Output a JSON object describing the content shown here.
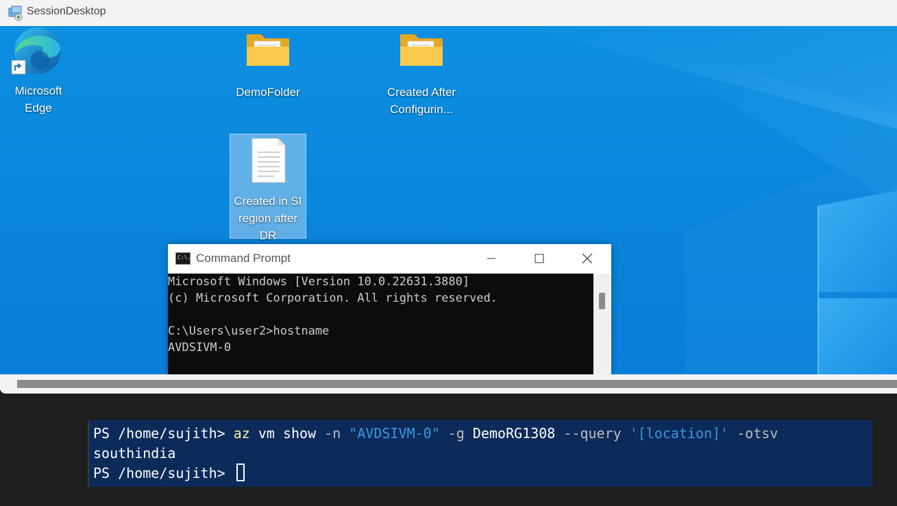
{
  "session": {
    "title": "SessionDesktop"
  },
  "desktop": {
    "icons": [
      {
        "label_line1": "Microsoft",
        "label_line2": "Edge",
        "icon": "edge-icon"
      },
      {
        "label_line1": "DemoFolder",
        "label_line2": "",
        "icon": "folder-icon"
      },
      {
        "label_line1": "Created After",
        "label_line2": "Configurin...",
        "icon": "folder-icon"
      },
      {
        "label_line1": "Created in SI",
        "label_line2": "region after",
        "label_line3": "DR",
        "icon": "text-file-icon"
      }
    ]
  },
  "cmd": {
    "title": "Command Prompt",
    "icon_text": "C:\\.",
    "lines": [
      "Microsoft Windows [Version 10.0.22631.3880]",
      "(c) Microsoft Corporation. All rights reserved.",
      "",
      "C:\\Users\\user2>hostname",
      "AVDSIVM-0"
    ]
  },
  "terminal": {
    "prompt": "PS /home/sujith> ",
    "cmd_az": "az",
    "cmd_rest_1": " vm show ",
    "flag_n": "-n",
    "str_name": " \"AVDSIVM-0\"",
    "flag_g": " -g",
    "rg": " DemoRG1308",
    "flag_query": " --query",
    "str_query": " '[location]'",
    "flag_o": " -otsv",
    "output": "southindia",
    "prompt2": "PS /home/sujith> "
  },
  "colors": {
    "desktop_blue": "#0a86dc",
    "terminal_selection": "#0d2b5a",
    "cmd_bg": "#0c0c0c"
  }
}
